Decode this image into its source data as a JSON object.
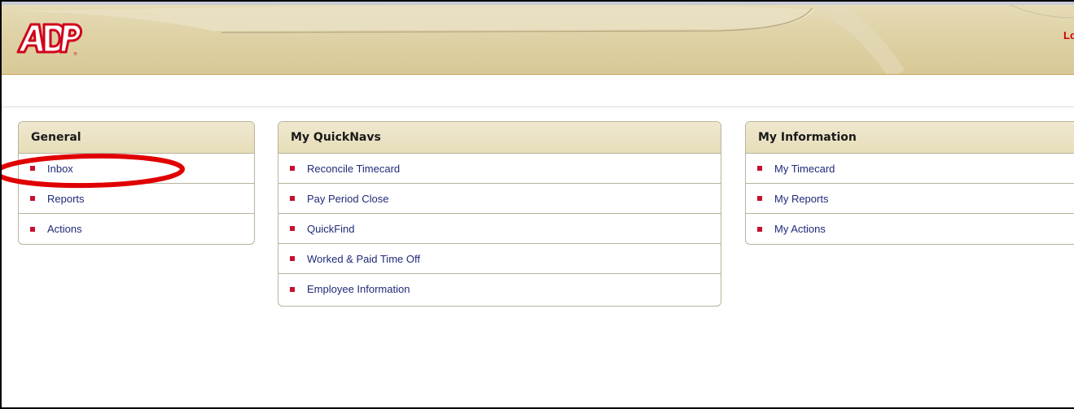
{
  "header": {
    "logo_text": "ADP",
    "top_right_link": "Lo"
  },
  "panels": {
    "general": {
      "title": "General",
      "items": [
        {
          "label": "Inbox"
        },
        {
          "label": "Reports"
        },
        {
          "label": "Actions"
        }
      ]
    },
    "quicknavs": {
      "title": "My QuickNavs",
      "items": [
        {
          "label": "Reconcile Timecard"
        },
        {
          "label": "Pay Period Close"
        },
        {
          "label": "QuickFind"
        },
        {
          "label": "Worked & Paid Time Off"
        },
        {
          "label": "Employee Information"
        }
      ]
    },
    "myinfo": {
      "title": "My Information",
      "items": [
        {
          "label": "My Timecard"
        },
        {
          "label": "My Reports"
        },
        {
          "label": "My Actions"
        }
      ]
    }
  },
  "annotation": {
    "highlighted_item": "Inbox",
    "color": "#e00000"
  },
  "colors": {
    "brand_red": "#cc0000",
    "bullet": "#c8102e",
    "link": "#1f2a78",
    "header_bg": "#ddd0a3",
    "panel_head_bg": "#e8e0c0"
  }
}
